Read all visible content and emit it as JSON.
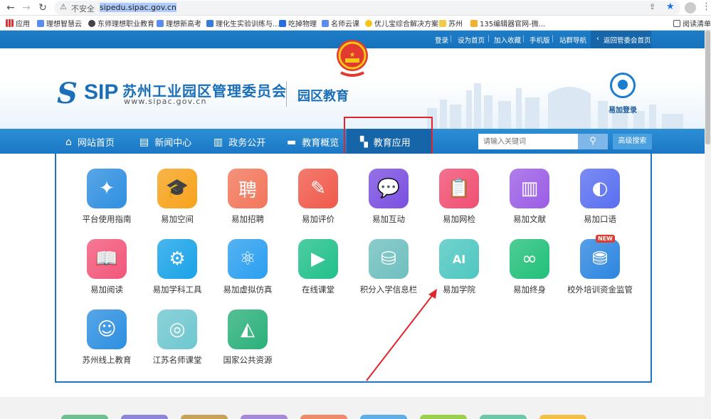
{
  "browser": {
    "security_label": "不安全",
    "url": "sipedu.sipac.gov.cn",
    "bookmarks": [
      "应用",
      "理想智慧云",
      "东师理想职业教育",
      "理想新高考",
      "理化生实验训练与...",
      "吃掉物理",
      "名师云课",
      "优儿宝综合解决方案",
      "苏州",
      "135编辑器官网-微..."
    ],
    "reading_list": "阅读清单"
  },
  "topbar": {
    "links": [
      "登录",
      "设为首页",
      "加入收藏",
      "手机版",
      "站群导航"
    ],
    "back_link": "返回管委会首页"
  },
  "header": {
    "logo_text": "SIP",
    "org_name": "苏州工业园区管理委员会",
    "org_url": "www.sipac.gov.cn",
    "sub_name": "园区教育",
    "login_label": "易加登录"
  },
  "nav": {
    "items": [
      "网站首页",
      "新闻中心",
      "政务公开",
      "教育概览",
      "教育应用"
    ],
    "active_index": 4,
    "search_placeholder": "请输入关键词",
    "advanced_search": "高级搜索"
  },
  "apps": [
    {
      "label": "平台使用指南",
      "color": "#2f8fe0",
      "icon": "compass-icon"
    },
    {
      "label": "易加空间",
      "color": "#f7a21b",
      "icon": "graduation-cap-icon"
    },
    {
      "label": "易加招聘",
      "color": "#f2765a",
      "icon": "recruit-icon"
    },
    {
      "label": "易加评价",
      "color": "#f05a4a",
      "icon": "pencil-icon"
    },
    {
      "label": "易加互动",
      "color": "#7a4fe0",
      "icon": "chat-icon"
    },
    {
      "label": "易加网检",
      "color": "#f04f72",
      "icon": "clipboard-icon"
    },
    {
      "label": "易加文献",
      "color": "#9b5de5",
      "icon": "books-icon"
    },
    {
      "label": "易加口语",
      "color": "#5a6ff0",
      "icon": "speech-icon"
    },
    {
      "label": "易加阅读",
      "color": "#f2577a",
      "icon": "book-icon"
    },
    {
      "label": "易加学科工具",
      "color": "#1aa3e8",
      "icon": "gears-icon"
    },
    {
      "label": "易加虚拟仿真",
      "color": "#2b9ff0",
      "icon": "atom-icon"
    },
    {
      "label": "在线课堂",
      "color": "#22c08a",
      "icon": "tv-icon"
    },
    {
      "label": "积分入学信息栏",
      "color": "#6fbfbf",
      "icon": "database-plus-icon"
    },
    {
      "label": "易加学院",
      "color": "#4fc7c0",
      "icon": "ai-head-icon"
    },
    {
      "label": "易加终身",
      "color": "#22c07a",
      "icon": "lifelong-icon"
    },
    {
      "label": "校外培训资金监管",
      "color": "#2d86e0",
      "icon": "coins-icon",
      "badge": "NEW"
    },
    {
      "label": "苏州线上教育",
      "color": "#2d8fe0",
      "icon": "people-icon"
    },
    {
      "label": "江苏名师课堂",
      "color": "#6fc7d0",
      "icon": "emblem-icon"
    },
    {
      "label": "国家公共资源",
      "color": "#2bb07a",
      "icon": "landscape-icon"
    }
  ],
  "bottom_colors": [
    "#6cc18f",
    "#8d86d8",
    "#c7a35a",
    "#a888d8",
    "#f08a6a",
    "#5faee8",
    "#9ad04a",
    "#6cc8a8",
    "#f2c04a"
  ]
}
